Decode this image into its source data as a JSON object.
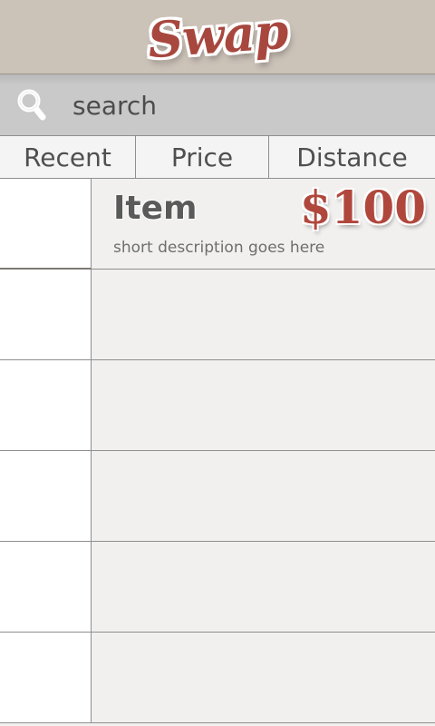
{
  "header": {
    "logo_text": "Swap"
  },
  "search": {
    "placeholder": "search",
    "value": ""
  },
  "tabs": [
    {
      "label": "Recent"
    },
    {
      "label": "Price"
    },
    {
      "label": "Distance"
    }
  ],
  "list": {
    "items": [
      {
        "title": "Item",
        "price": "$100",
        "description": "short description goes here"
      },
      {
        "title": "",
        "price": "",
        "description": ""
      },
      {
        "title": "",
        "price": "",
        "description": ""
      },
      {
        "title": "",
        "price": "",
        "description": ""
      },
      {
        "title": "",
        "price": "",
        "description": ""
      },
      {
        "title": "",
        "price": "",
        "description": ""
      }
    ]
  },
  "colors": {
    "header_bg": "#cbc2b8",
    "brand_red": "#a7473e",
    "search_bg": "#c9c9c9",
    "text_gray": "#4f4f4f"
  },
  "icons": {
    "search": "search-icon"
  }
}
